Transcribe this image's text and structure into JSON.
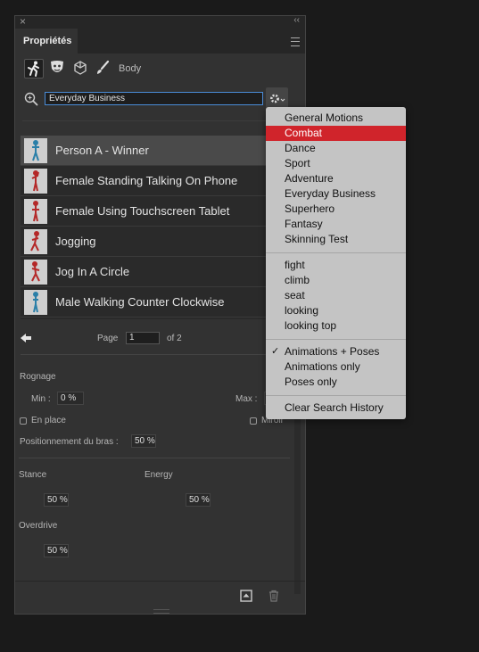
{
  "panel": {
    "close_glyph": "×",
    "collapse_glyph": "‹‹",
    "tab_label": "Propriétés",
    "mode_label": "Body",
    "modes": [
      "figure-icon",
      "mask-icon",
      "cube-icon",
      "brush-icon"
    ]
  },
  "search": {
    "value": "Everyday Business"
  },
  "motions": [
    {
      "label": "Person A - Winner",
      "selected": true
    },
    {
      "label": "Female Standing Talking On Phone",
      "selected": false
    },
    {
      "label": "Female Using Touchscreen Tablet",
      "selected": false
    },
    {
      "label": "Jogging",
      "selected": false
    },
    {
      "label": "Jog In A Circle",
      "selected": false
    },
    {
      "label": "Male Walking Counter Clockwise",
      "selected": false
    }
  ],
  "pager": {
    "page_label": "Page",
    "page_value": "1",
    "of_label": "of 2"
  },
  "settings": {
    "trim_label": "Rognage",
    "min_label": "Min :",
    "min_value": "0 %",
    "max_label": "Max :",
    "in_place_label": "En place",
    "mirror_label": "Miroir",
    "arm_label": "Positionnement du bras :",
    "arm_value": "50 %",
    "stance_label": "Stance",
    "stance_value": "50 %",
    "energy_label": "Energy",
    "energy_value": "50 %",
    "overdrive_label": "Overdrive",
    "overdrive_value": "50 %"
  },
  "dropdown": {
    "categories": [
      "General Motions",
      "Combat",
      "Dance",
      "Sport",
      "Adventure",
      "Everyday Business",
      "Superhero",
      "Fantasy",
      "Skinning Test"
    ],
    "highlighted": "Combat",
    "recent": [
      "fight",
      "climb",
      "seat",
      "looking",
      "looking top"
    ],
    "filters": [
      "Animations + Poses",
      "Animations only",
      "Poses only"
    ],
    "checked_filter": "Animations + Poses",
    "check_glyph": "✓",
    "clear_label": "Clear Search History"
  },
  "colors": {
    "highlight": "#d0242b",
    "focus_border": "#4a8cd8",
    "panel_bg": "#323232",
    "figure_blue": "#2a7fa8",
    "figure_red": "#b42828"
  }
}
